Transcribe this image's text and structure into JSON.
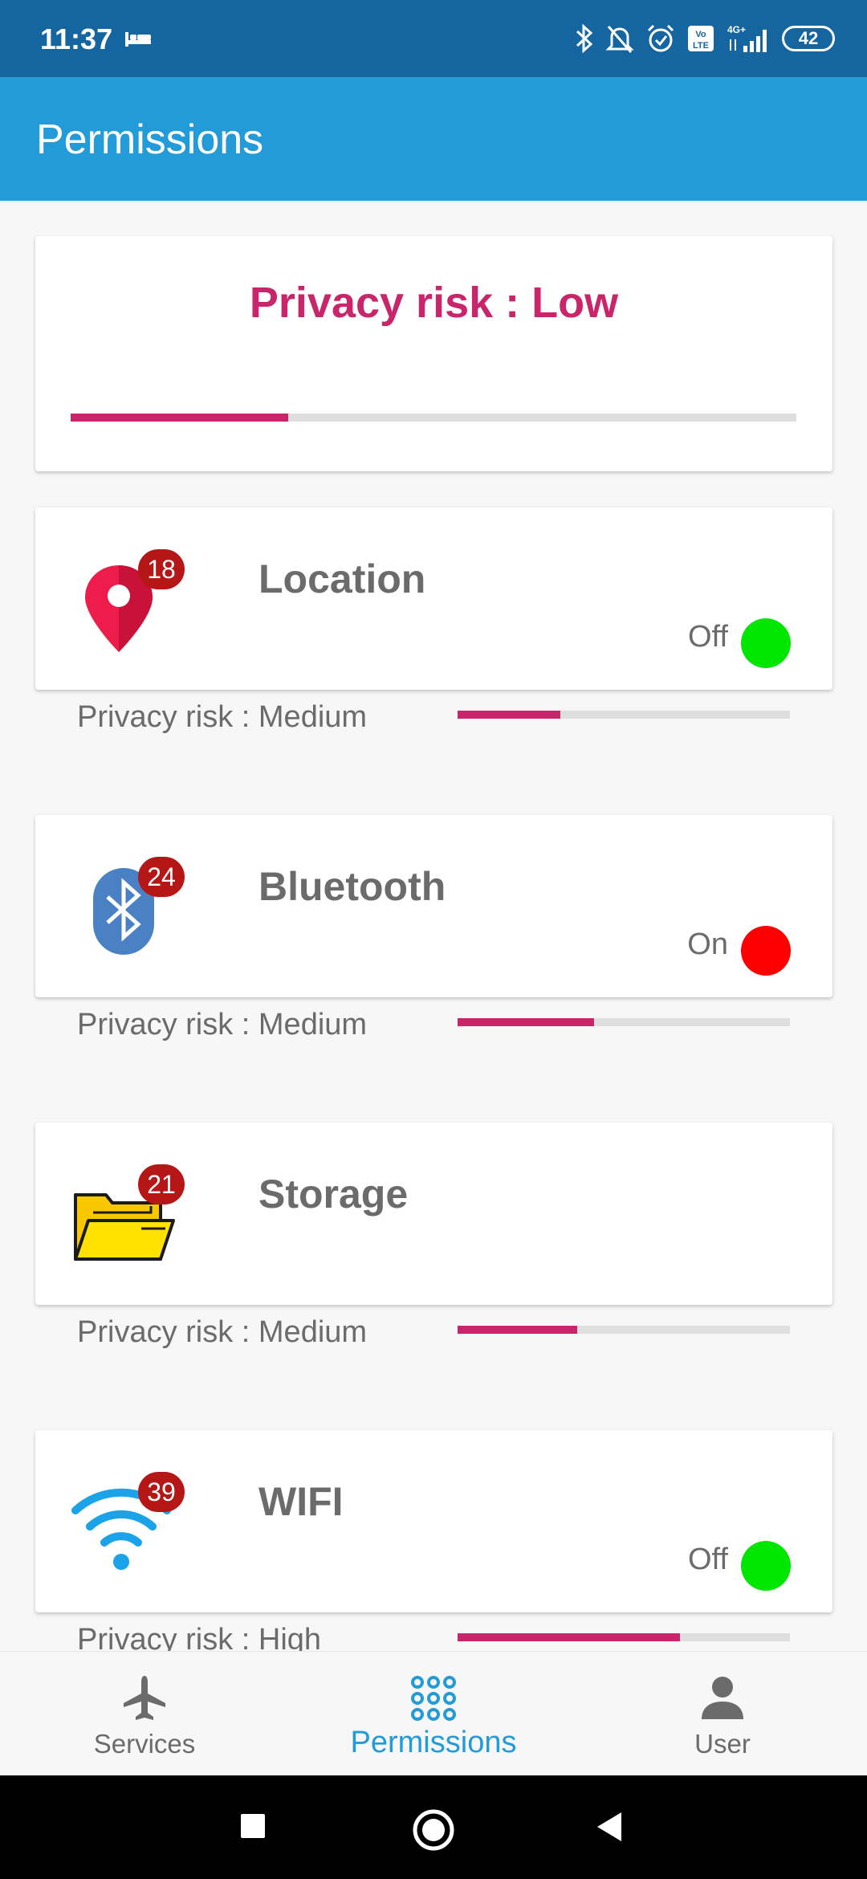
{
  "status_bar": {
    "time": "11:37",
    "battery": "42",
    "icons": [
      "sleep-icon",
      "bluetooth-icon",
      "bell-off-icon",
      "alarm-icon",
      "volte-icon",
      "signal-icon",
      "battery-icon"
    ]
  },
  "app_bar": {
    "title": "Permissions"
  },
  "summary": {
    "title": "Privacy risk : Low",
    "risk_fraction": 0.3
  },
  "colors": {
    "primary": "#229bd8",
    "status_bar": "#1565a0",
    "risk_accent": "#c8256a",
    "toggle_off": "#00e600",
    "toggle_on": "#ff0000",
    "badge": "#b51616"
  },
  "permissions": [
    {
      "name": "Location",
      "count": "18",
      "icon": "location-pin-icon",
      "toggle": "Off",
      "risk": "Privacy risk : Medium",
      "risk_fraction": 0.31
    },
    {
      "name": "Bluetooth",
      "count": "24",
      "icon": "bluetooth-icon",
      "toggle": "On",
      "risk": "Privacy risk : Medium",
      "risk_fraction": 0.41
    },
    {
      "name": "Storage",
      "count": "21",
      "icon": "folder-icon",
      "toggle": "",
      "risk": "Privacy risk : Medium",
      "risk_fraction": 0.36
    },
    {
      "name": "WIFI",
      "count": "39",
      "icon": "wifi-icon",
      "toggle": "Off",
      "risk": "Privacy risk : High",
      "risk_fraction": 0.67
    }
  ],
  "bottom_nav": {
    "items": [
      {
        "label": "Services",
        "icon": "airplane-icon",
        "active": false
      },
      {
        "label": "Permissions",
        "icon": "grid-icon",
        "active": true
      },
      {
        "label": "User",
        "icon": "person-icon",
        "active": false
      }
    ]
  },
  "system_nav": [
    "recents-button",
    "home-button",
    "back-button"
  ]
}
